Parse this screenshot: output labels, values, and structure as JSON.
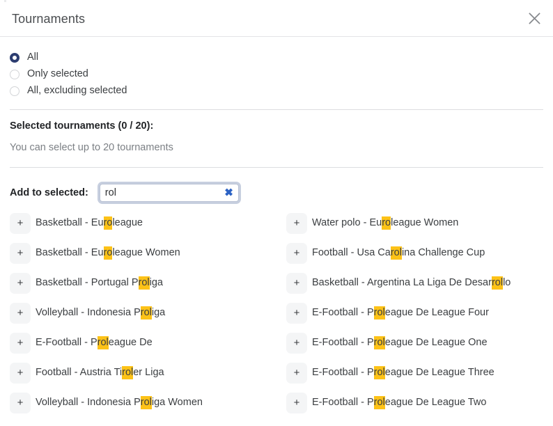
{
  "dialog": {
    "title": "Tournaments",
    "close_icon": "close-icon"
  },
  "filter_mode": {
    "selected_value": "All",
    "options": [
      {
        "label": "All",
        "checked": true
      },
      {
        "label": "Only selected",
        "checked": false
      },
      {
        "label": "All, excluding selected",
        "checked": false
      }
    ]
  },
  "selected_section": {
    "title": "Selected tournaments (0 / 20):",
    "count": 0,
    "max": 20,
    "hint": "You can select up to 20 tournaments"
  },
  "search": {
    "label": "Add to selected:",
    "value": "rol",
    "placeholder": "",
    "clear_icon": "✖",
    "query": "rol"
  },
  "results": {
    "add_button_label": "+",
    "left_column": [
      {
        "prefix": "Basketball - Eu",
        "match": "ro",
        "suffix": "league"
      },
      {
        "prefix": "Basketball - Eu",
        "match": "ro",
        "suffix": "league Women"
      },
      {
        "prefix": "Basketball - Portugal P",
        "match": "rol",
        "suffix": "iga"
      },
      {
        "prefix": "Volleyball - Indonesia P",
        "match": "rol",
        "suffix": "iga"
      },
      {
        "prefix": "E-Football - P",
        "match": "rol",
        "suffix": "eague De"
      },
      {
        "prefix": "Football - Austria Ti",
        "match": "rol",
        "suffix": "er Liga"
      },
      {
        "prefix": "Volleyball - Indonesia P",
        "match": "rol",
        "suffix": "iga Women"
      }
    ],
    "right_column": [
      {
        "prefix": "Water polo - Eu",
        "match": "ro",
        "suffix": "league Women"
      },
      {
        "prefix": "Football - Usa Ca",
        "match": "rol",
        "suffix": "ina Challenge Cup"
      },
      {
        "prefix": "Basketball - Argentina La Liga De Desar",
        "match": "rol",
        "suffix": "lo"
      },
      {
        "prefix": "E-Football - P",
        "match": "rol",
        "suffix": "eague De League Four"
      },
      {
        "prefix": "E-Football - P",
        "match": "rol",
        "suffix": "eague De League One"
      },
      {
        "prefix": "E-Football - P",
        "match": "rol",
        "suffix": "eague De League Three"
      },
      {
        "prefix": "E-Football - P",
        "match": "rol",
        "suffix": "eague De League Two"
      }
    ]
  },
  "colors": {
    "highlight": "#fdc217",
    "radio_checked": "#2c3d70",
    "clear_icon": "#2b62c4",
    "focus_ring": "#c7cfdf",
    "add_button_bg": "#f4f5f6",
    "text": "#3b3e41",
    "muted_text": "#7c8085",
    "separator": "#dcdde0"
  }
}
